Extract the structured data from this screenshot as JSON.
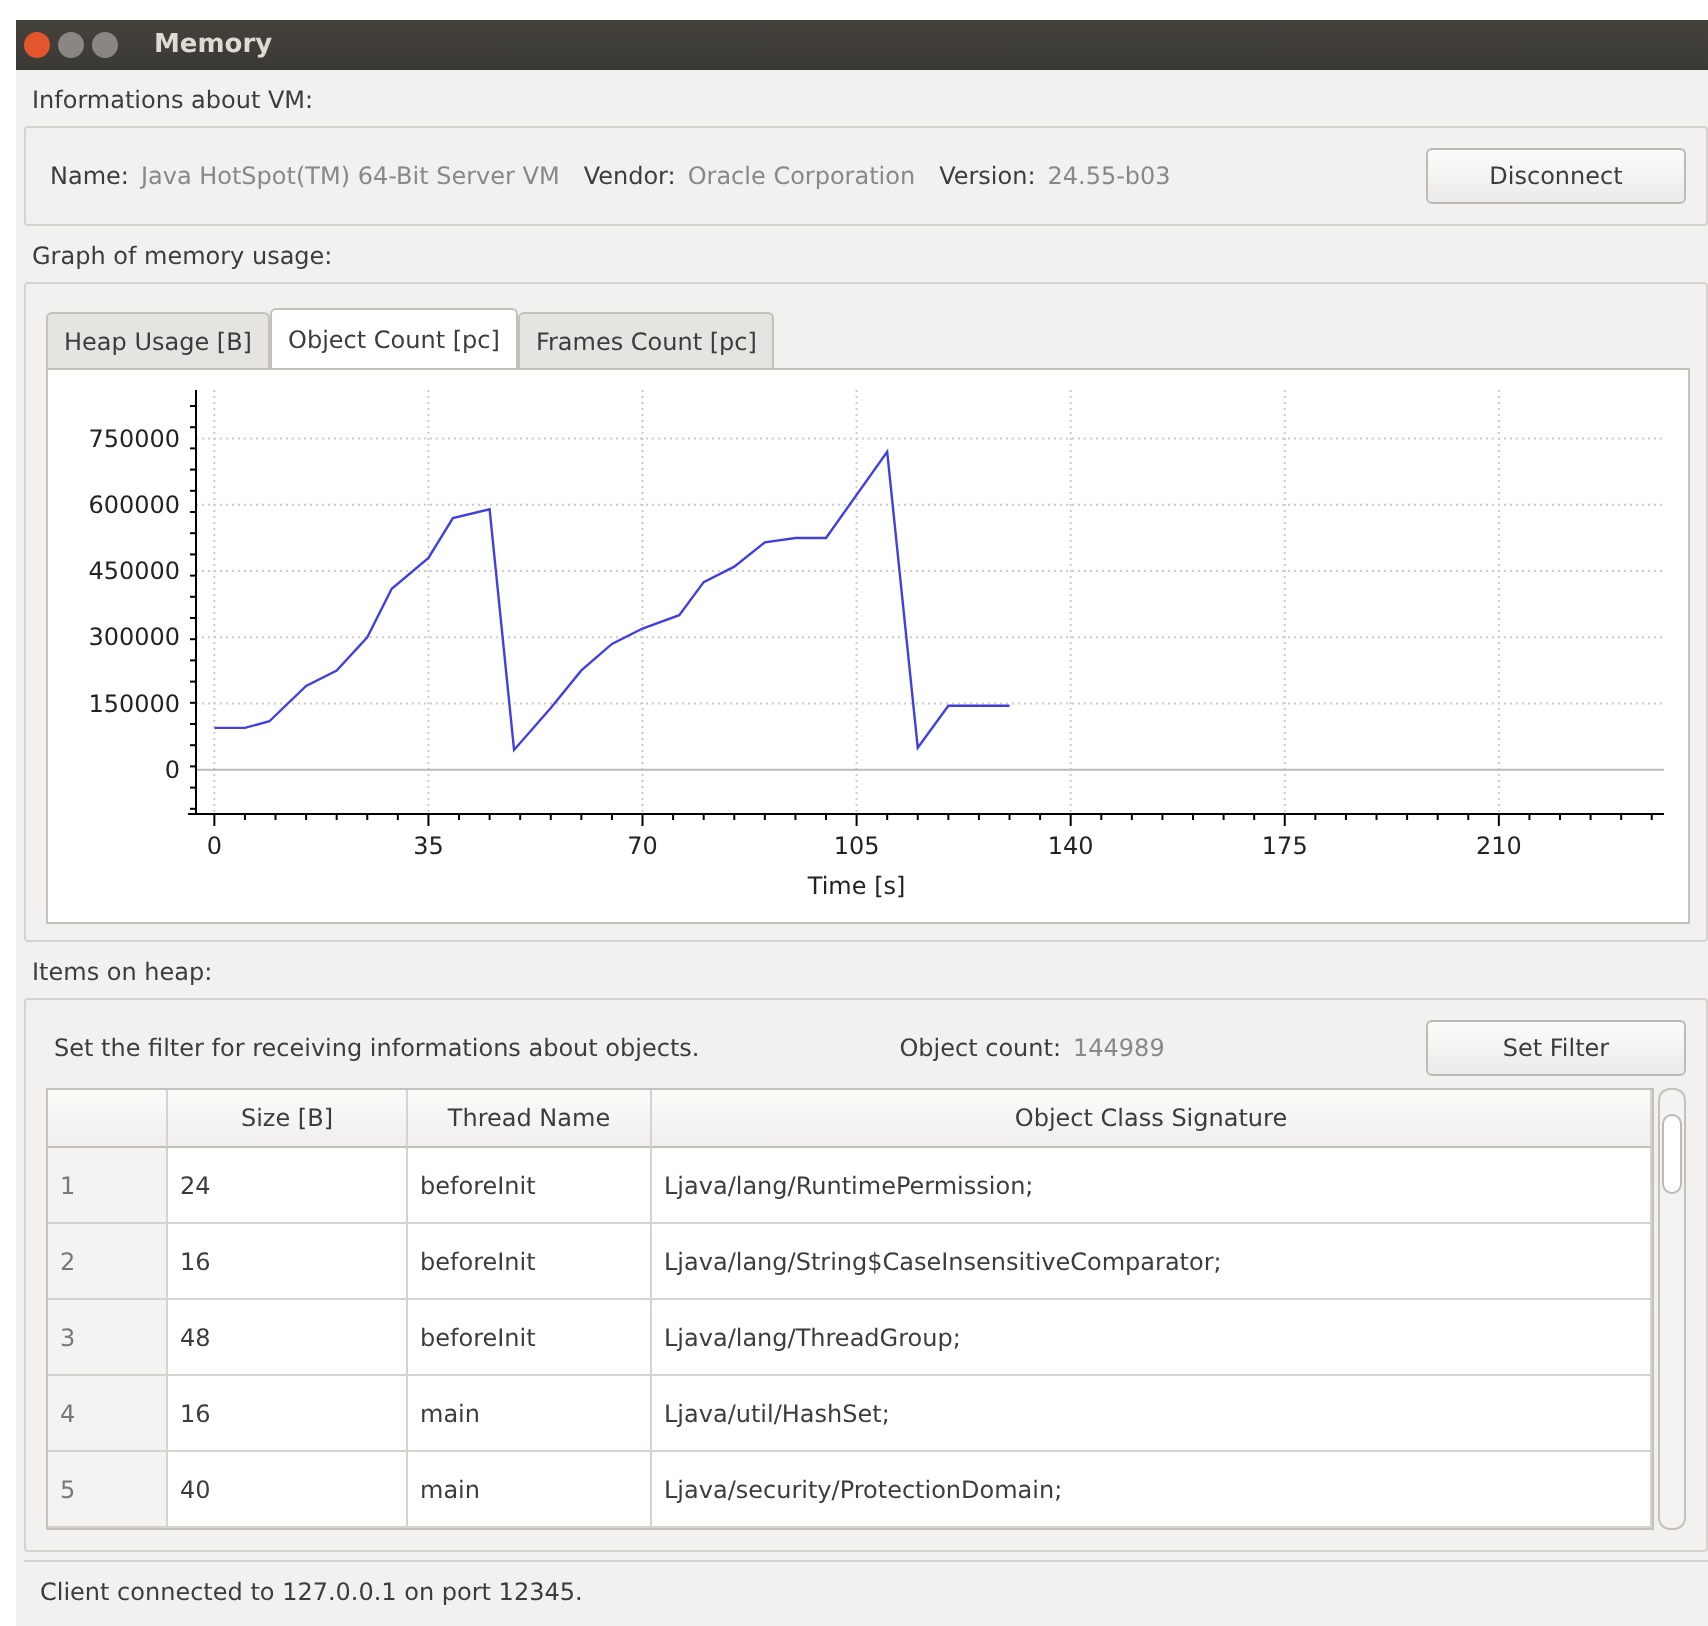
{
  "window": {
    "title": "Memory"
  },
  "vm_info": {
    "heading": "Informations about VM:",
    "fields": [
      {
        "label": "Name:",
        "value": "Java HotSpot(TM) 64-Bit Server VM"
      },
      {
        "label": "Vendor:",
        "value": "Oracle Corporation"
      },
      {
        "label": "Version:",
        "value": "24.55-b03"
      }
    ],
    "button": "Disconnect"
  },
  "graph": {
    "heading": "Graph of memory usage:",
    "tabs": [
      {
        "label": "Heap Usage [B]",
        "selected": false
      },
      {
        "label": "Object Count [pc]",
        "selected": true
      },
      {
        "label": "Frames Count [pc]",
        "selected": false
      }
    ],
    "chart_data": {
      "type": "line",
      "xlabel": "Time [s]",
      "x": [
        0,
        5,
        9,
        15,
        20,
        25,
        29,
        35,
        39,
        45,
        49,
        55,
        60,
        65,
        70,
        76,
        80,
        85,
        90,
        95,
        100,
        110,
        115,
        120,
        130
      ],
      "grid": true,
      "series": [
        {
          "color": "#4040e0",
          "values": [
            95000,
            95000,
            110000,
            190000,
            225000,
            300000,
            410000,
            480000,
            570000,
            590000,
            45000,
            140000,
            225000,
            285000,
            320000,
            350000,
            425000,
            460000,
            515000,
            525000,
            525000,
            720000,
            50000,
            145000,
            145000
          ]
        }
      ],
      "xlim": [
        -3,
        237
      ],
      "ylim": [
        -100000,
        860000
      ],
      "xticks": [
        0,
        35,
        70,
        105,
        140,
        175,
        210
      ],
      "yticks": [
        0,
        150000,
        300000,
        450000,
        600000,
        750000
      ]
    }
  },
  "heap": {
    "heading": "Items on heap:",
    "filter_text": "Set the filter for receiving informations about objects.",
    "count_label": "Object count:",
    "count_value": "144989",
    "button": "Set Filter",
    "columns": [
      "Size [B]",
      "Thread Name",
      "Object Class Signature"
    ],
    "rows": [
      {
        "index": "1",
        "size": "24",
        "thread": "beforeInit",
        "signature": "Ljava/lang/RuntimePermission;"
      },
      {
        "index": "2",
        "size": "16",
        "thread": "beforeInit",
        "signature": "Ljava/lang/String$CaseInsensitiveComparator;"
      },
      {
        "index": "3",
        "size": "48",
        "thread": "beforeInit",
        "signature": "Ljava/lang/ThreadGroup;"
      },
      {
        "index": "4",
        "size": "16",
        "thread": "main",
        "signature": "Ljava/util/HashSet;"
      },
      {
        "index": "5",
        "size": "40",
        "thread": "main",
        "signature": "Ljava/security/ProtectionDomain;"
      }
    ]
  },
  "status_bar": "Client connected to 127.0.0.1 on port 12345."
}
